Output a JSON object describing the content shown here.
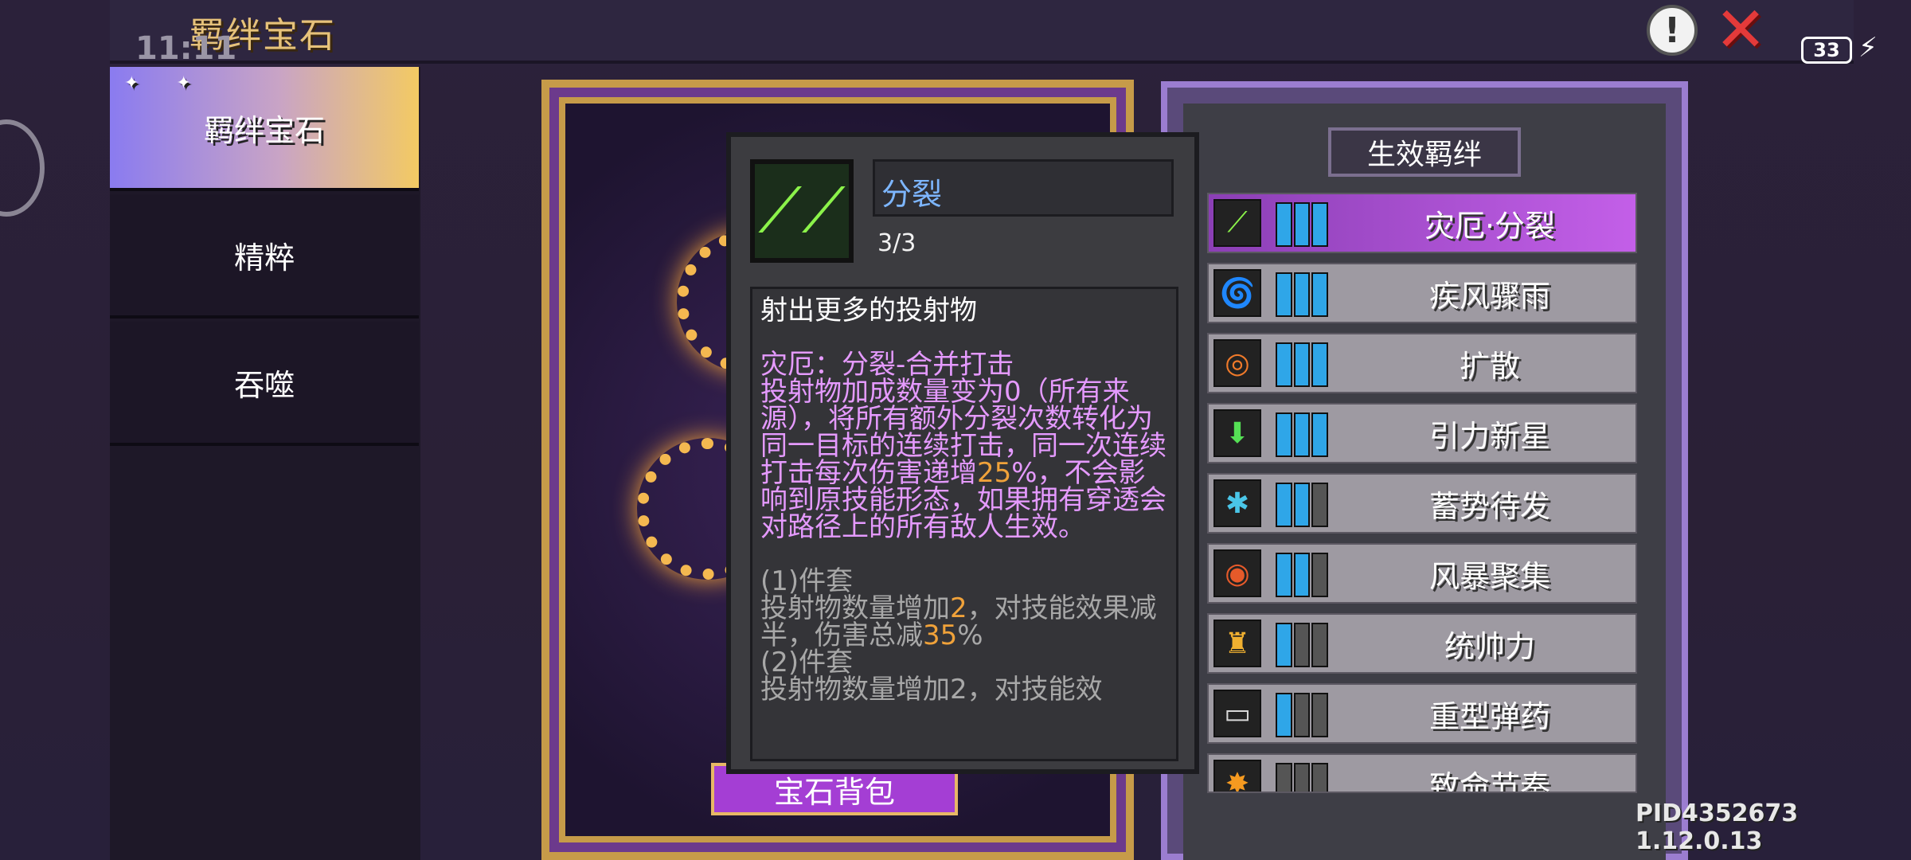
{
  "header": {
    "title": "羁绊宝石",
    "clock": "11:11",
    "battery": "33"
  },
  "tabs": [
    {
      "label": "羁绊宝石"
    },
    {
      "label": "精粹"
    },
    {
      "label": "吞噬"
    }
  ],
  "card": {
    "button_label": "宝石背包"
  },
  "panel": {
    "title": "生效羁绊",
    "bonds": [
      {
        "label": "灾厄·分裂",
        "icon": "split-icon",
        "level": 3,
        "active": true
      },
      {
        "label": "疾风骤雨",
        "icon": "tornado-icon",
        "level": 3
      },
      {
        "label": "扩散",
        "icon": "diffuse-icon",
        "level": 3
      },
      {
        "label": "引力新星",
        "icon": "gravity-icon",
        "level": 3
      },
      {
        "label": "蓄势待发",
        "icon": "charge-icon",
        "level": 2
      },
      {
        "label": "风暴聚集",
        "icon": "storm-icon",
        "level": 2
      },
      {
        "label": "统帅力",
        "icon": "command-icon",
        "level": 1
      },
      {
        "label": "重型弹药",
        "icon": "ammo-icon",
        "level": 1
      },
      {
        "label": "致命节奏",
        "icon": "explosion-icon",
        "level": 0
      }
    ]
  },
  "tooltip": {
    "name": "分裂",
    "count": "3/3",
    "description": "射出更多的投射物",
    "curse_title": "灾厄：分裂-合并打击",
    "curse_text_1": "投射物加成数量变为0（所有来源），将所有额外分裂次数转化为同一目标的连续打击，同一次连续打击每次伤害递增",
    "curse_hl": "25",
    "curse_text_2": "%，不会影响到原技能形态，如果拥有穿透会对路径上的所有敌人生效。",
    "set1_title": "(1)件套",
    "set1_text_a": "投射物数量增加",
    "set1_hl_a": "2",
    "set1_text_b": "，对技能效果减半，伤害总减",
    "set1_hl_b": "35",
    "set1_text_c": "%",
    "set2_title": "(2)件套",
    "set2_text": "投射物数量增加2，对技能效"
  },
  "footer": {
    "pid": "PID4352673 1.12.0.13"
  },
  "colors": {
    "accent_gold": "#c69b49",
    "active_purple": "#c35fe8",
    "bar_blue": "#2fa6e8",
    "highlight_orange": "#f0a23a",
    "curse_pink": "#e59aff"
  }
}
